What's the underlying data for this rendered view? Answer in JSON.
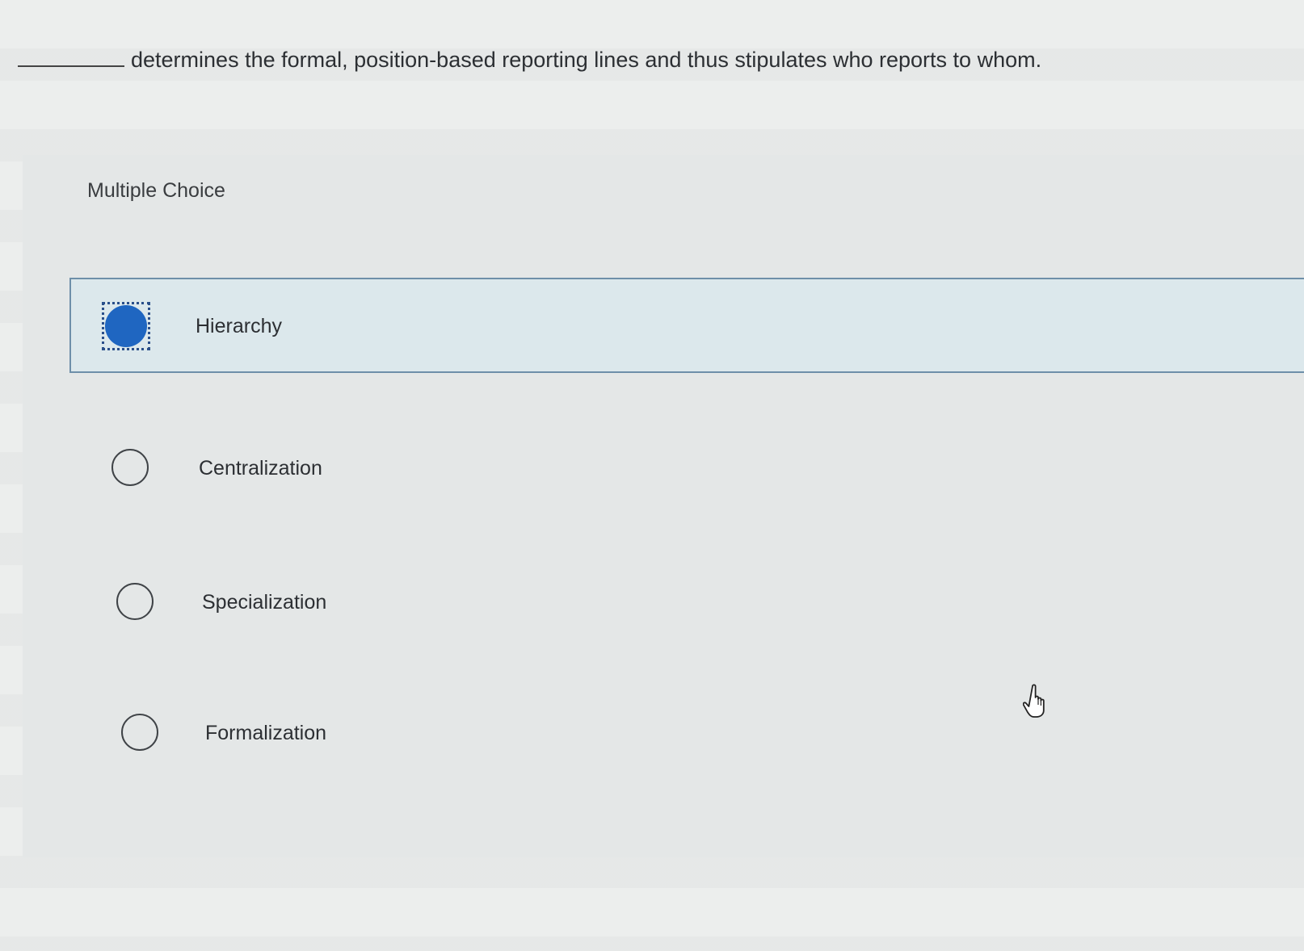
{
  "question": {
    "blank": "",
    "text": "determines the formal, position-based reporting lines and thus stipulates who reports to whom."
  },
  "multiple_choice": {
    "title": "Multiple Choice",
    "options": [
      {
        "label": "Hierarchy",
        "selected": true
      },
      {
        "label": "Centralization",
        "selected": false
      },
      {
        "label": "Specialization",
        "selected": false
      },
      {
        "label": "Formalization",
        "selected": false
      }
    ]
  },
  "colors": {
    "selected_radio": "#1f66c1",
    "selected_row_bg": "#dce8ec",
    "selected_row_border": "#6e8fa9"
  },
  "icons": {
    "cursor": "hand-pointer-icon"
  }
}
